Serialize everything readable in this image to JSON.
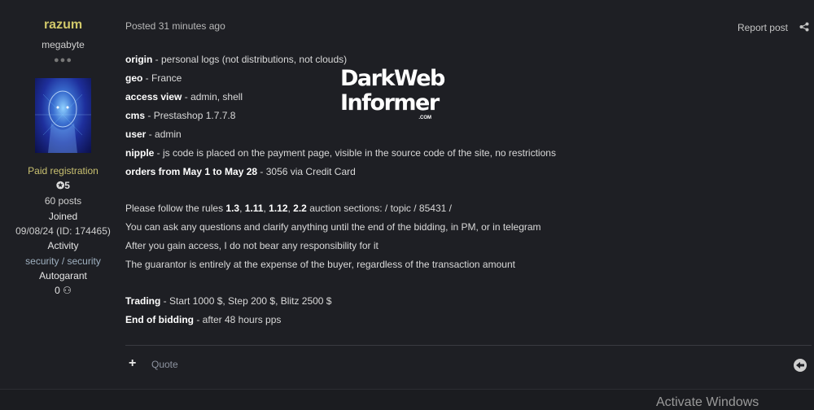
{
  "author": {
    "username": "razum",
    "rank": "megabyte",
    "pips": "●●●",
    "group": "Paid registration",
    "reputation": "5",
    "posts": "60 posts",
    "joined_label": "Joined",
    "joined_value": "09/08/24 (ID: 174465)",
    "activity_label": "Activity",
    "activity_value": "security / security",
    "autogarant_label": "Autogarant",
    "autogarant_value": "0"
  },
  "post": {
    "posted": "Posted 31 minutes ago",
    "report": "Report post",
    "fields": [
      {
        "label": "origin",
        "value": " - personal logs (not distributions, not clouds)"
      },
      {
        "label": "geo",
        "value": " - France"
      },
      {
        "label": "access view",
        "value": " - admin, shell"
      },
      {
        "label": "cms",
        "value": " - Prestashop 1.7.7.8"
      },
      {
        "label": "user",
        "value": " - admin"
      },
      {
        "label": "nipple",
        "value": " - js code is placed on the payment page, visible in the source code of the site, no restrictions"
      },
      {
        "label": "orders from May 1 to May 28",
        "value": " - 3056 via Credit Card"
      }
    ],
    "rules_prefix": "Please follow the rules ",
    "rules": [
      "1.3",
      "1.11",
      "1.12",
      "2.2"
    ],
    "rules_suffix": " auction sections: / topic / 85431 /",
    "lines": [
      "You can ask any questions and clarify anything until the end of the bidding, in PM, or in telegram",
      "After you gain access, I do not bear any responsibility for it",
      "The guarantor is entirely at the expense of the buyer, regardless of the transaction amount"
    ],
    "trading_label": "Trading",
    "trading_value": " - Start 1000 $, Step 200 $, Blitz 2500 $",
    "end_label": "End of bidding",
    "end_value": " - after 48 hours pps"
  },
  "logo": {
    "line1": "DarkWeb",
    "line2": "Informer",
    "com": ".COM"
  },
  "footer": {
    "plus": "+",
    "quote": "Quote"
  },
  "watermark": "Activate Windows"
}
